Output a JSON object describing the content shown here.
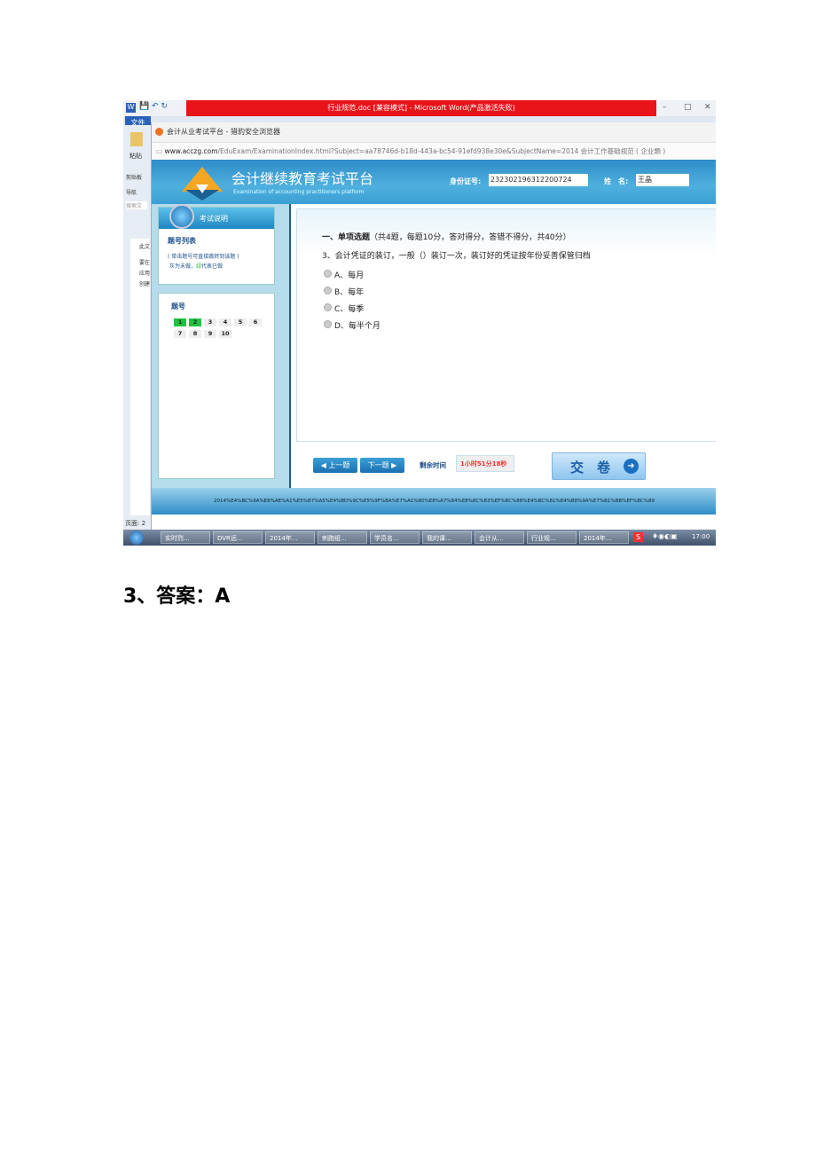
{
  "word": {
    "title": "行业规范.doc [兼容模式] - Microsoft Word(产品激活失败)",
    "file_tab": "文件",
    "paste": "粘贴",
    "clipboard": "剪贴板",
    "nav": "导航",
    "search": "搜索文",
    "side_text": [
      "此文",
      "要在",
      "应用",
      "创建"
    ],
    "page": "页面: 2"
  },
  "browser": {
    "title": "会计从业考试平台 - 猎豹安全浏览器",
    "url_host": "www.acczg.com",
    "url_path": "/EduExam/ExaminationIndex.html?Subject=aa78746d-b18d-443a-bc54-91efd938e30e&SubjectName=2014 会计工作基础规范 ( 企业類 )"
  },
  "header": {
    "title": "会计继续教育考试平台",
    "subtitle": "Examination of accounting practitioners platform",
    "id_label": "身份证号:",
    "id_value": "232302196312200724",
    "name_label": "姓　名:",
    "name_value": "王晶"
  },
  "sidebar": {
    "exam_info": "考试说明",
    "list_title": "题号列表",
    "hint": "( 单击题号可直接跳转到该题 )",
    "legend_gray": "灰为未做，",
    "legend_green": "绿",
    "legend_rest": "代表已做",
    "numbers_title": "题号",
    "numbers": [
      {
        "n": "1",
        "done": true
      },
      {
        "n": "2",
        "done": true
      },
      {
        "n": "3",
        "done": false
      },
      {
        "n": "4",
        "done": false
      },
      {
        "n": "5",
        "done": false
      },
      {
        "n": "6",
        "done": false
      },
      {
        "n": "7",
        "done": false
      },
      {
        "n": "8",
        "done": false
      },
      {
        "n": "9",
        "done": false
      },
      {
        "n": "10",
        "done": false
      }
    ]
  },
  "question": {
    "section": "一、单项选题",
    "section_note": "（共4题，每题10分，答对得分，答错不得分，共40分）",
    "text": "3、会计凭证的装订，一般（）装订一次，装订好的凭证按年份妥善保管归档",
    "options": [
      "A、每月",
      "B、每年",
      "C、每季",
      "D、每半个月"
    ]
  },
  "controls": {
    "prev": "◀ 上一题",
    "next": "下一题 ▶",
    "remaining_label": "剩余时间",
    "remaining": "1小时51分18秒",
    "submit": "交　卷"
  },
  "footer": "2014%E4%BC%9A%E8%AE%A1%E5%B7%A5%E4%BD%9C%E5%9F%BA%E7%A1%80%E8%A7%84%E8%8C%83%EF%BC%88%E4%BC%81%E4%B8%9A%E7%B1%BB%EF%BC%89",
  "taskbar": {
    "items": [
      "实时烈...",
      "DVR远...",
      "2014年...",
      "刺跑组...",
      "学员名...",
      "我的课...",
      "会计从...",
      "行业规...",
      "2014年..."
    ],
    "clock": "17:00"
  },
  "answer": "3、答案：A"
}
